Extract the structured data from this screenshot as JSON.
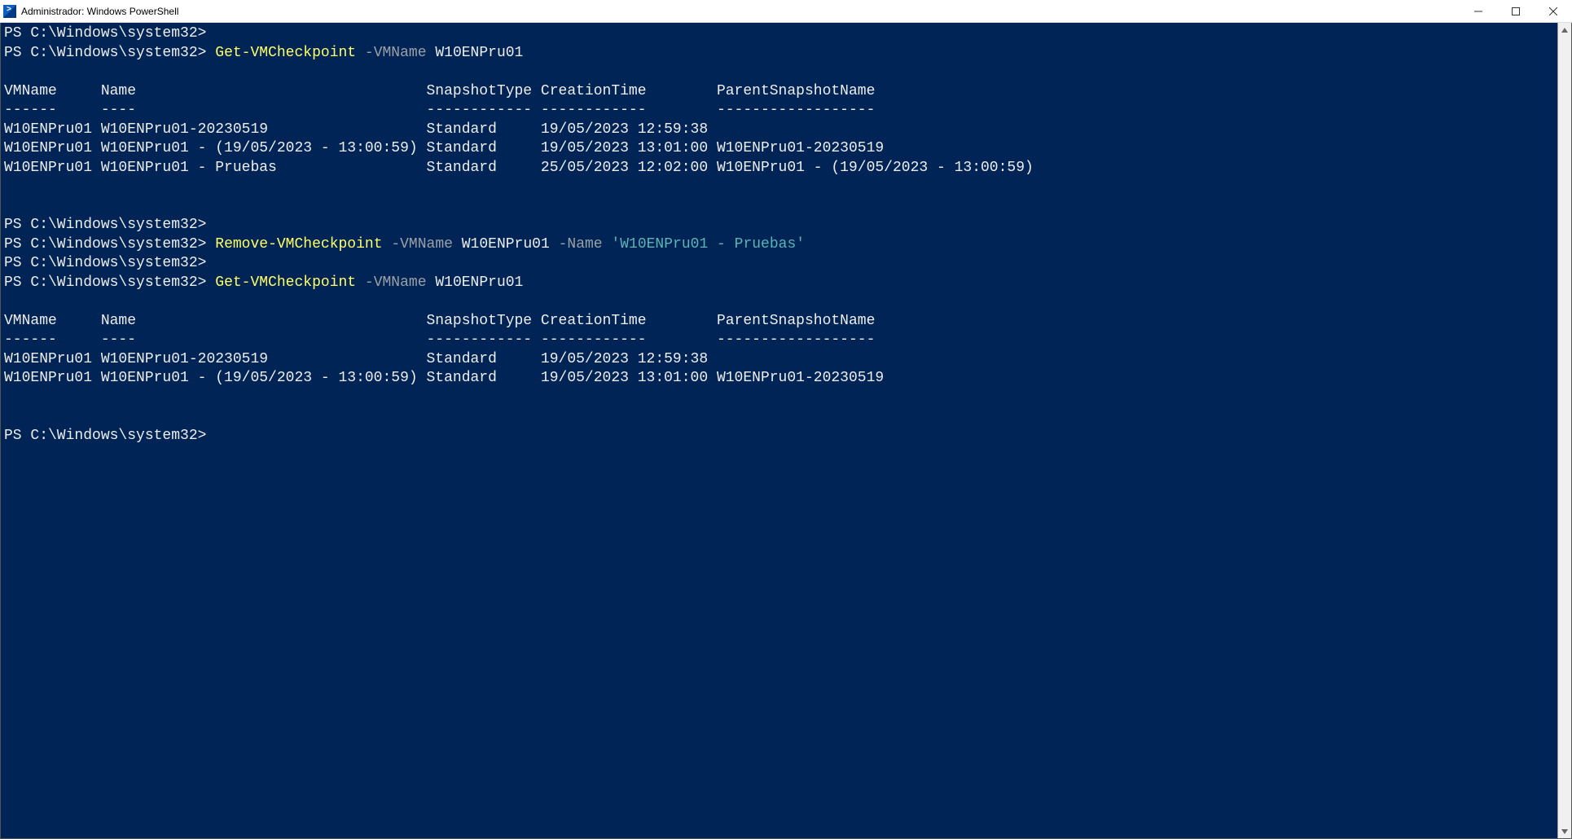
{
  "window": {
    "title": "Administrador: Windows PowerShell"
  },
  "prompt": "PS C:\\Windows\\system32>",
  "cmd1": {
    "cmdlet": "Get-VMCheckpoint",
    "param": "-VMName",
    "vm": "W10ENPru01"
  },
  "cmd2": {
    "cmdlet": "Remove-VMCheckpoint",
    "param1": "-VMName",
    "vm": "W10ENPru01",
    "param2": "-Name",
    "name_string": "'W10ENPru01 - Pruebas'"
  },
  "cmd3": {
    "cmdlet": "Get-VMCheckpoint",
    "param": "-VMName",
    "vm": "W10ENPru01"
  },
  "table_headers": {
    "vmname": "VMName",
    "name": "Name",
    "snapshottype": "SnapshotType",
    "creationtime": "CreationTime",
    "parentsnapshotname": "ParentSnapshotName"
  },
  "table_dash": {
    "vmname": "------",
    "name": "----",
    "snapshottype": "------------",
    "creationtime": "------------",
    "parentsnapshotname": "------------------"
  },
  "table1_rows": [
    {
      "vmname": "W10ENPru01",
      "name": "W10ENPru01-20230519",
      "snapshottype": "Standard",
      "creationtime": "19/05/2023 12:59:38",
      "parentsnapshotname": ""
    },
    {
      "vmname": "W10ENPru01",
      "name": "W10ENPru01 - (19/05/2023 - 13:00:59)",
      "snapshottype": "Standard",
      "creationtime": "19/05/2023 13:01:00",
      "parentsnapshotname": "W10ENPru01-20230519"
    },
    {
      "vmname": "W10ENPru01",
      "name": "W10ENPru01 - Pruebas",
      "snapshottype": "Standard",
      "creationtime": "25/05/2023 12:02:00",
      "parentsnapshotname": "W10ENPru01 - (19/05/2023 - 13:00:59)"
    }
  ],
  "table2_rows": [
    {
      "vmname": "W10ENPru01",
      "name": "W10ENPru01-20230519",
      "snapshottype": "Standard",
      "creationtime": "19/05/2023 12:59:38",
      "parentsnapshotname": ""
    },
    {
      "vmname": "W10ENPru01",
      "name": "W10ENPru01 - (19/05/2023 - 13:00:59)",
      "snapshottype": "Standard",
      "creationtime": "19/05/2023 13:01:00",
      "parentsnapshotname": "W10ENPru01-20230519"
    }
  ]
}
